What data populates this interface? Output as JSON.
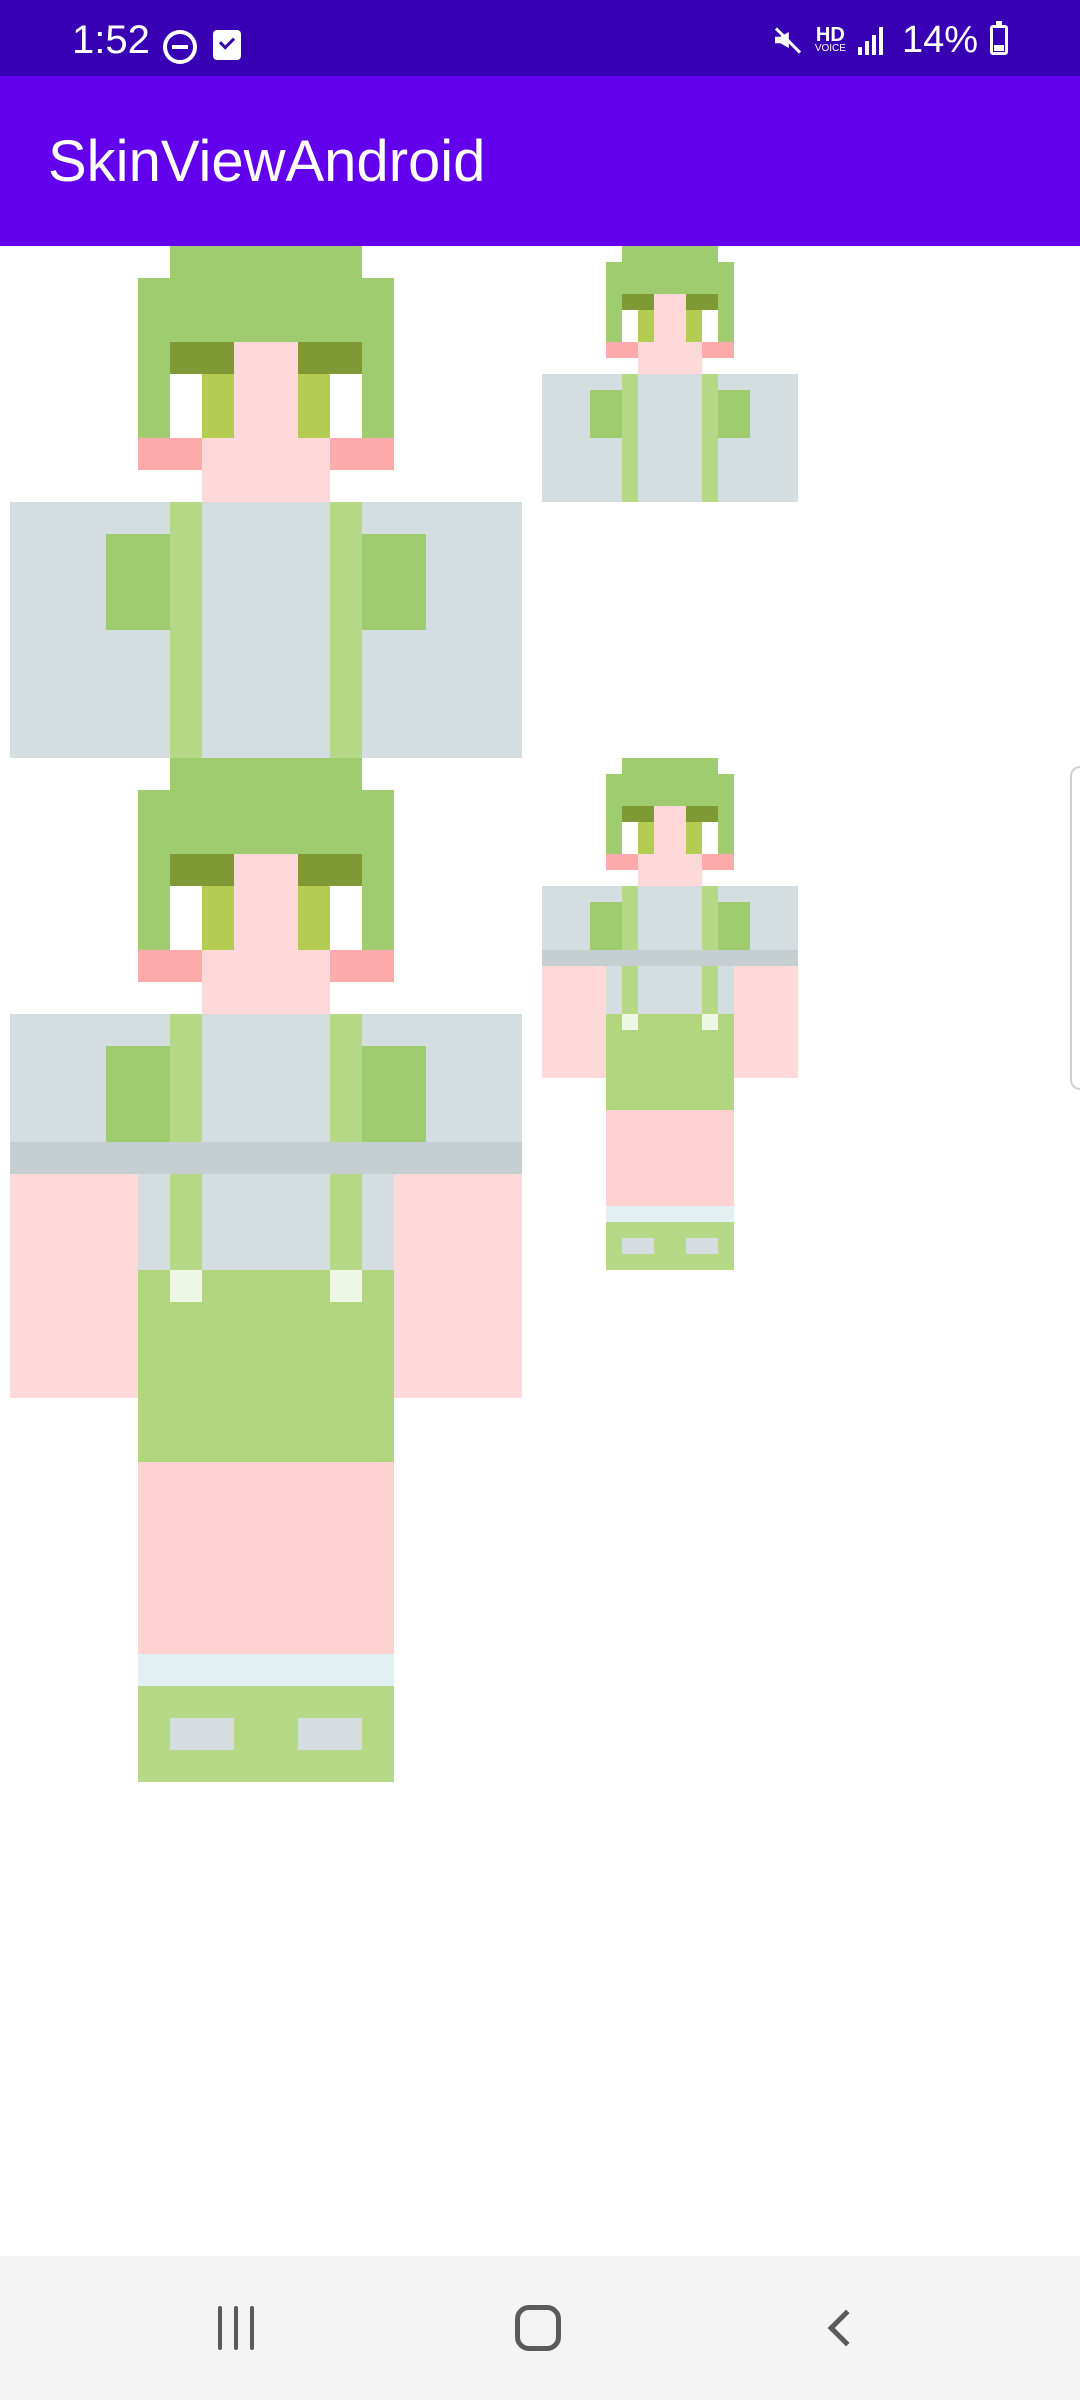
{
  "status_bar": {
    "time": "1:52",
    "hd_label": "HD",
    "hd_sub": "VOICE",
    "battery": "14%",
    "icons": [
      "do-not-disturb-icon",
      "task-check-icon",
      "mute-icon",
      "hd-voice-icon",
      "signal-icon",
      "battery-charging-icon"
    ]
  },
  "app_bar": {
    "title": "SkinViewAndroid"
  },
  "skin_views": [
    {
      "name": "head-torso-large",
      "variant": "upper"
    },
    {
      "name": "head-torso-small",
      "variant": "upper"
    },
    {
      "name": "full-body-large",
      "variant": "full"
    },
    {
      "name": "full-body-small",
      "variant": "full"
    }
  ],
  "colors": {
    "status_bar": "#3700b3",
    "app_bar": "#6200ee",
    "hair": "#9fcc6e",
    "skin": "#ffd9d9",
    "shirt": "#d4dde0",
    "suspenders": "#b5d986",
    "shorts": "#b2d67f",
    "socks": "#ffd2d2"
  },
  "nav_bar": {
    "icons": [
      "recents-icon",
      "home-icon",
      "back-icon"
    ]
  }
}
